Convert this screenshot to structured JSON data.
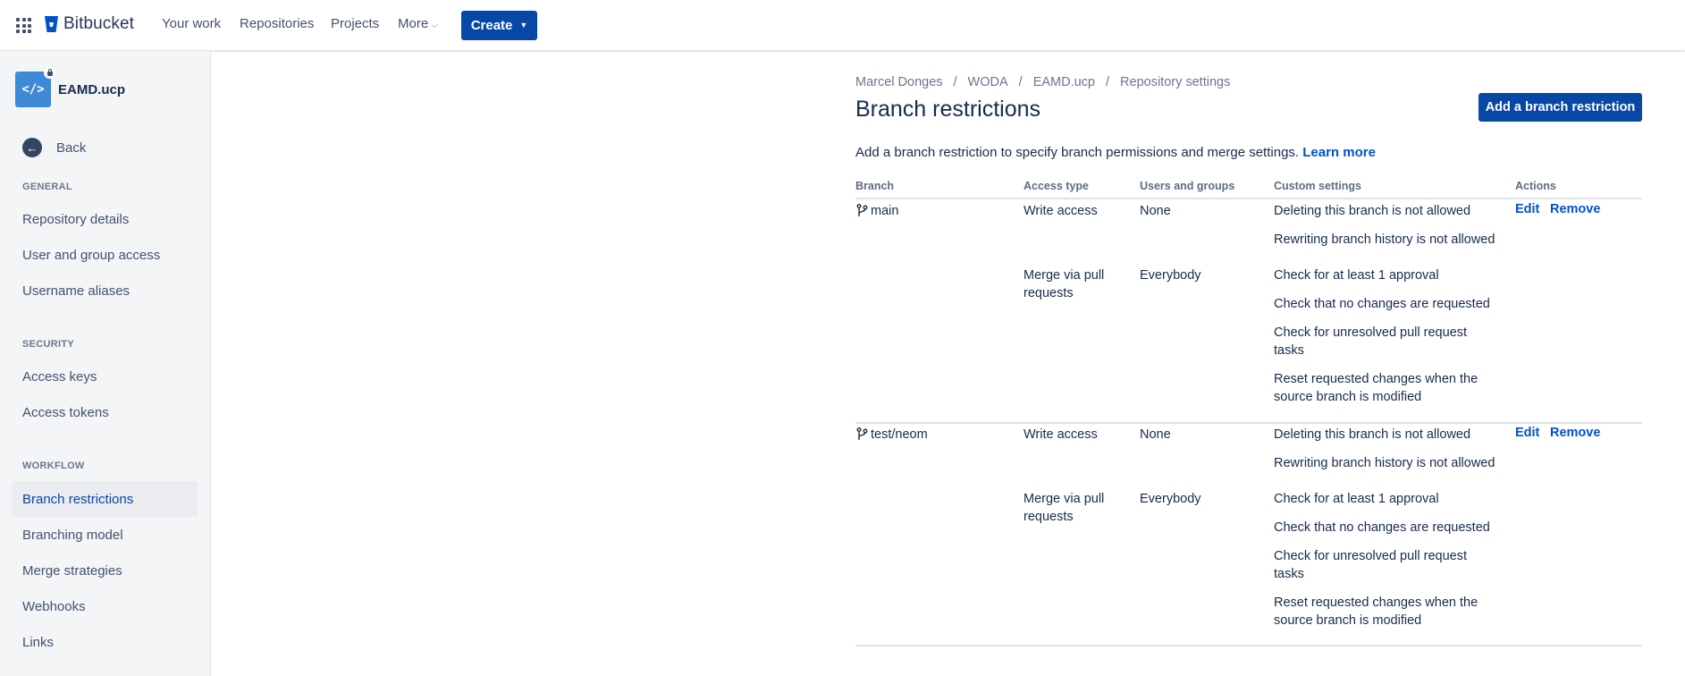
{
  "topnav": {
    "product": "Bitbucket",
    "items": [
      "Your work",
      "Repositories",
      "Projects",
      "More"
    ],
    "create_label": "Create"
  },
  "sidebar": {
    "repo_name": "EAMD.ucp",
    "back_label": "Back",
    "sections": [
      {
        "title": "GENERAL",
        "items": [
          "Repository details",
          "User and group access",
          "Username aliases"
        ]
      },
      {
        "title": "SECURITY",
        "items": [
          "Access keys",
          "Access tokens"
        ]
      },
      {
        "title": "WORKFLOW",
        "items": [
          "Branch restrictions",
          "Branching model",
          "Merge strategies",
          "Webhooks",
          "Links"
        ]
      }
    ],
    "active_item": "Branch restrictions"
  },
  "breadcrumb": [
    "Marcel Donges",
    "WODA",
    "EAMD.ucp",
    "Repository settings"
  ],
  "page": {
    "title": "Branch restrictions",
    "add_button": "Add a branch restriction",
    "intro": "Add a branch restriction to specify branch permissions and merge settings.",
    "learn_more": "Learn more"
  },
  "table": {
    "headers": [
      "Branch",
      "Access type",
      "Users and groups",
      "Custom settings",
      "Actions"
    ],
    "rows": [
      {
        "branch": "main",
        "write_access": "Write access",
        "write_users": "None",
        "write_settings": [
          "Deleting this branch is not allowed",
          "Rewriting branch history is not allowed"
        ],
        "merge_access": "Merge via pull requests",
        "merge_users": "Everybody",
        "merge_settings": [
          "Check for at least 1 approval",
          "Check that no changes are requested",
          "Check for unresolved pull request tasks",
          "Reset requested changes when the source branch is modified"
        ],
        "edit": "Edit",
        "remove": "Remove"
      },
      {
        "branch": "test/neom",
        "write_access": "Write access",
        "write_users": "None",
        "write_settings": [
          "Deleting this branch is not allowed",
          "Rewriting branch history is not allowed"
        ],
        "merge_access": "Merge via pull requests",
        "merge_users": "Everybody",
        "merge_settings": [
          "Check for at least 1 approval",
          "Check that no changes are requested",
          "Check for unresolved pull request tasks",
          "Reset requested changes when the source branch is modified"
        ],
        "edit": "Edit",
        "remove": "Remove"
      }
    ]
  },
  "colors": {
    "primary": "#0747a6",
    "link": "#0052cc",
    "sidebar_bg": "#f4f5f7",
    "text": "#172b4d"
  }
}
